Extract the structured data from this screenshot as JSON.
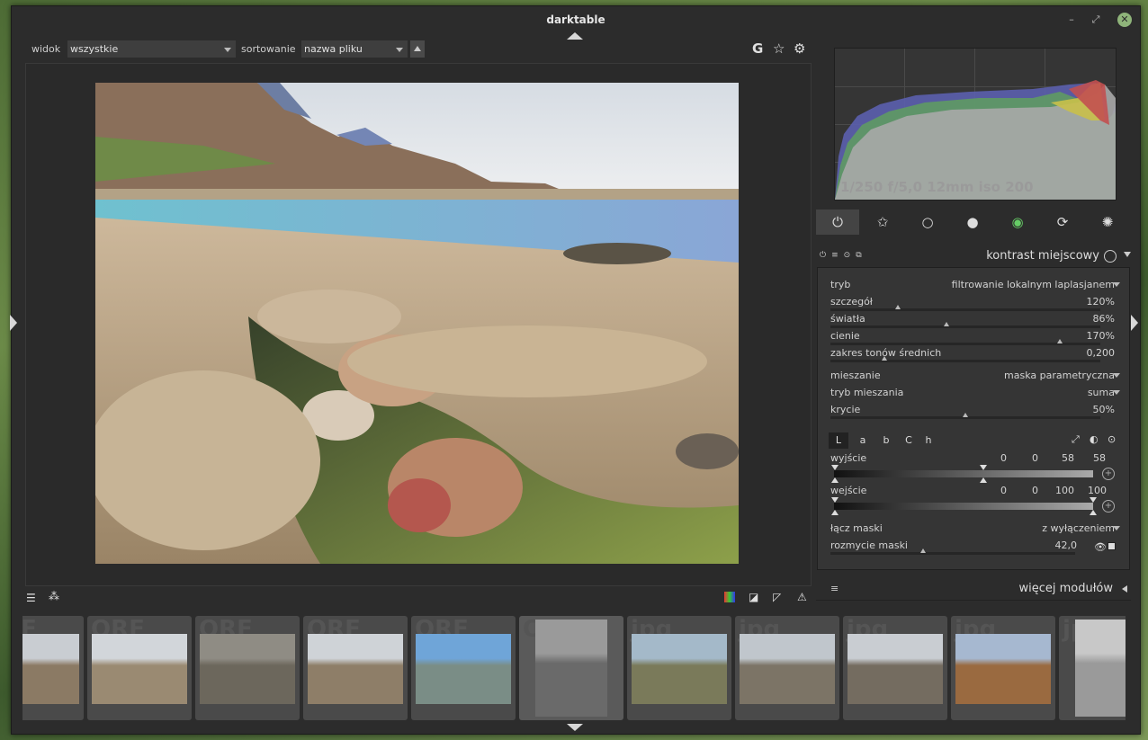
{
  "window": {
    "title": "darktable"
  },
  "topbar": {
    "view_label": "widok",
    "view_value": "wszystkie",
    "sort_label": "sortowanie",
    "sort_value": "nazwa pliku",
    "icons": [
      "g-icon",
      "star-icon",
      "gear-icon"
    ]
  },
  "histogram": {
    "exif": "1/250 f/5,0 12mm iso 200"
  },
  "module_groups": [
    "power-icon",
    "star-icon",
    "circle-icon",
    "sphere-icon",
    "color-circle-icon",
    "rotate-icon",
    "aperture-icon"
  ],
  "module": {
    "title": "kontrast miejscowy",
    "rows": [
      {
        "key": "tryb",
        "value": "filtrowanie lokalnym laplasjanem",
        "type": "dropdown"
      },
      {
        "key": "szczegół",
        "value": "120%",
        "type": "slider",
        "level": 0.25
      },
      {
        "key": "światła",
        "value": "86%",
        "type": "slider",
        "level": 0.43
      },
      {
        "key": "cienie",
        "value": "170%",
        "type": "slider",
        "level": 0.85
      },
      {
        "key": "zakres tonów średnich",
        "value": "0,200",
        "type": "slider",
        "level": 0.2
      },
      {
        "key": "mieszanie",
        "value": "maska parametryczna",
        "type": "dropdown"
      },
      {
        "key": "tryb mieszania",
        "value": "suma",
        "type": "dropdown"
      },
      {
        "key": "krycie",
        "value": "50%",
        "type": "slider",
        "level": 0.5
      }
    ],
    "channels": [
      "L",
      "a",
      "b",
      "C",
      "h"
    ],
    "output_label": "wyjście",
    "output_values": [
      "0",
      "0",
      "58",
      "58"
    ],
    "input_label": "wejście",
    "input_values": [
      "0",
      "0",
      "100",
      "100"
    ],
    "combine_label": "łącz maski",
    "combine_value": "z wyłączeniem",
    "blur_label": "rozmycie maski",
    "blur_value": "42,0",
    "blur_level": 0.38
  },
  "more_modules": "więcej modułów",
  "filmstrip": {
    "extensions": [
      "ORF",
      "ORF",
      "ORF",
      "ORF",
      "ORF",
      "ORF",
      "jpg",
      "jpg",
      "jpg",
      "jpg",
      "jpg"
    ]
  }
}
